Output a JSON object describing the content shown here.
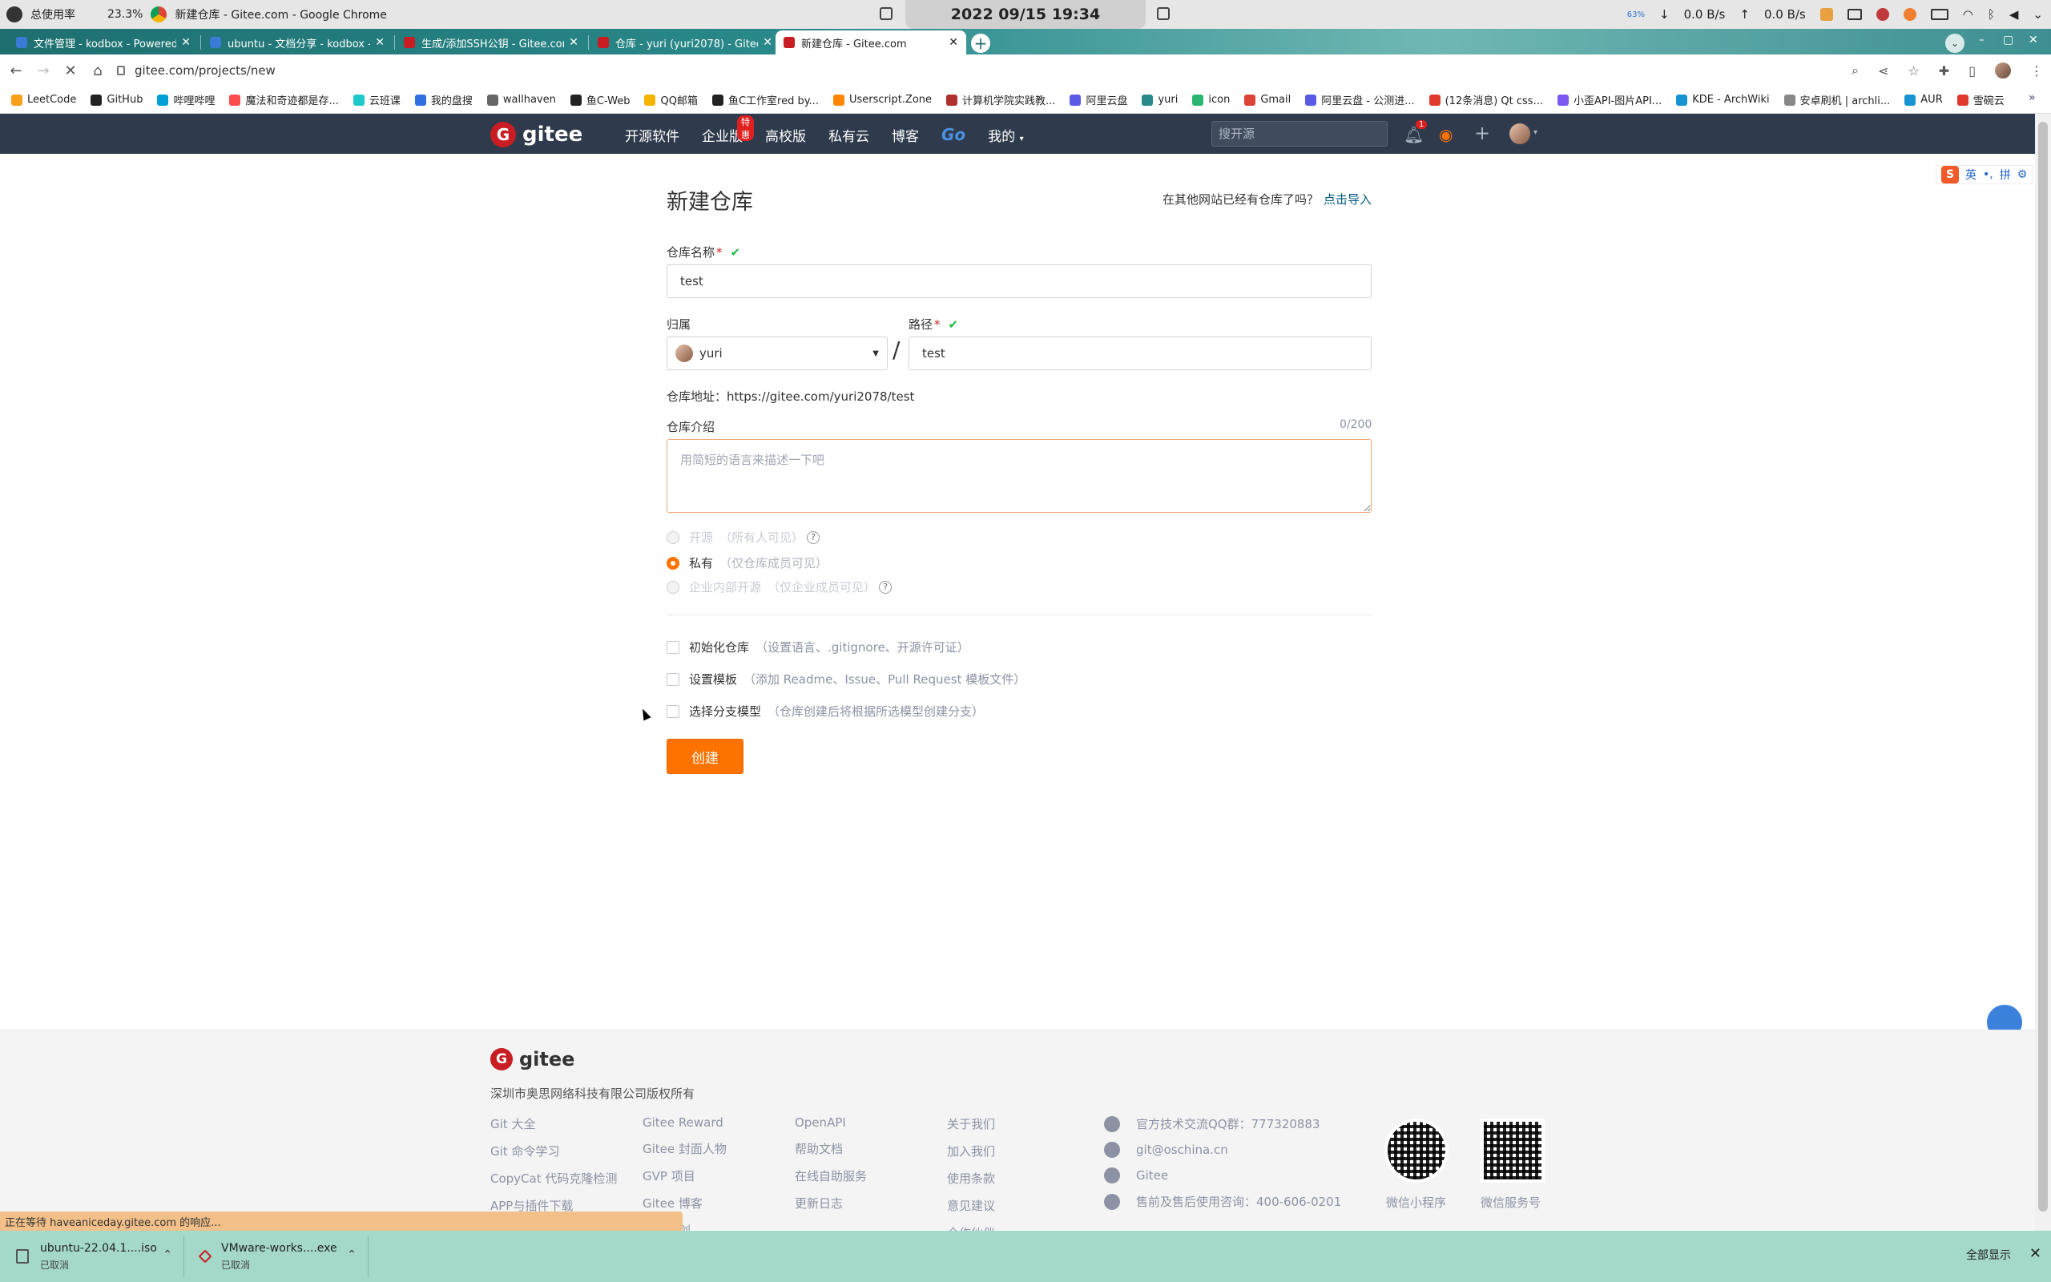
{
  "os_panel": {
    "cpu_label": "总使用率",
    "cpu_value": "23.3%",
    "window_title": "新建仓库 - Gitee.com - Google Chrome",
    "clock": "2022 09/15 19:34",
    "net_down": "0.0 B/s",
    "net_up": "0.0 B/s",
    "battery_small": "63%"
  },
  "tabs": [
    {
      "title": "文件管理 - kodbox - Powered",
      "color": "#3a7bd5"
    },
    {
      "title": "ubuntu - 文档分享 - kodbox -",
      "color": "#3a7bd5"
    },
    {
      "title": "生成/添加SSH公钥 - Gitee.com",
      "color": "#c71d23"
    },
    {
      "title": "仓库 - yuri (yuri2078) - Gitee.c",
      "color": "#c71d23"
    },
    {
      "title": "新建仓库 - Gitee.com",
      "color": "#c71d23",
      "active": true
    }
  ],
  "address": {
    "url": "gitee.com/projects/new"
  },
  "bookmarks": [
    {
      "label": "LeetCode",
      "color": "#f89f1b"
    },
    {
      "label": "GitHub",
      "color": "#222"
    },
    {
      "label": "哔哩哔哩",
      "color": "#00a1d6"
    },
    {
      "label": "魔法和奇迹都是存...",
      "color": "#ff4d4f"
    },
    {
      "label": "云班课",
      "color": "#1ec8c8"
    },
    {
      "label": "我的盘搜",
      "color": "#2f6fe0"
    },
    {
      "label": "wallhaven",
      "color": "#666"
    },
    {
      "label": "鱼C-Web",
      "color": "#222"
    },
    {
      "label": "QQ邮箱",
      "color": "#f4b400"
    },
    {
      "label": "鱼C工作室red by...",
      "color": "#222"
    },
    {
      "label": "Userscript.Zone",
      "color": "#ff8800"
    },
    {
      "label": "计算机学院实践教...",
      "color": "#b03030"
    },
    {
      "label": "阿里云盘",
      "color": "#5a5ae6"
    },
    {
      "label": "yuri",
      "color": "#2a8a8b"
    },
    {
      "label": "icon",
      "color": "#2ab573"
    },
    {
      "label": "Gmail",
      "color": "#db4437"
    },
    {
      "label": "阿里云盘 - 公测进...",
      "color": "#5a5ae6"
    },
    {
      "label": "(12条消息) Qt css...",
      "color": "#e03a2f"
    },
    {
      "label": "小歪API-图片API...",
      "color": "#7a5af0"
    },
    {
      "label": "KDE - ArchWiki",
      "color": "#1793d1"
    },
    {
      "label": "安卓刷机 | archli...",
      "color": "#888"
    },
    {
      "label": "AUR",
      "color": "#1793d1"
    },
    {
      "label": "雪碗云",
      "color": "#e03a2f"
    }
  ],
  "gitee_header": {
    "brand": "gitee",
    "brand_letter": "G",
    "nav": [
      "开源软件",
      "企业版",
      "高校版",
      "私有云",
      "博客"
    ],
    "nav_go": "Go",
    "nav_mine": "我的",
    "enterprise_badge": "特惠",
    "search_placeholder": "搜开源",
    "notif_count": "1"
  },
  "form": {
    "title": "新建仓库",
    "import_hint": "在其他网站已经有仓库了吗？",
    "import_link": "点击导入",
    "repo_name_label": "仓库名称",
    "repo_name_value": "test",
    "owner_label": "归属",
    "owner_value": "yuri",
    "path_label": "路径",
    "path_value": "test",
    "slash": "/",
    "repo_address": "仓库地址：https://gitee.com/yuri2078/test",
    "desc_label": "仓库介绍",
    "desc_counter": "0/200",
    "desc_placeholder": "用简短的语言来描述一下吧",
    "visibility": [
      {
        "label": "开源",
        "sub": "（所有人可见）",
        "disabled": true,
        "help": true
      },
      {
        "label": "私有",
        "sub": "（仅仓库成员可见）",
        "selected": true
      },
      {
        "label": "企业内部开源",
        "sub": "（仅企业成员可见）",
        "disabled": true,
        "help": true
      }
    ],
    "options": [
      {
        "label": "初始化仓库",
        "sub": "（设置语言、.gitignore、开源许可证）"
      },
      {
        "label": "设置模板",
        "sub": "（添加 Readme、Issue、Pull Request 模板文件）"
      },
      {
        "label": "选择分支模型",
        "sub": "（仓库创建后将根据所选模型创建分支）"
      }
    ],
    "create_button": "创建"
  },
  "ime": {
    "mode": "英",
    "pinyin": "拼"
  },
  "footer": {
    "brand": "gitee",
    "copyright": "深圳市奥思网络科技有限公司版权所有",
    "col1": [
      "Git 大全",
      "Git 命令学习",
      "CopyCat 代码克隆检测",
      "APP与插件下载"
    ],
    "col2": [
      "Gitee Reward",
      "Gitee 封面人物",
      "GVP 项目",
      "Gitee 博客",
      "公益计划"
    ],
    "col3": [
      "OpenAPI",
      "帮助文档",
      "在线自助服务",
      "更新日志"
    ],
    "col4": [
      "关于我们",
      "加入我们",
      "使用条款",
      "意见建议",
      "合作伙伴"
    ],
    "contacts": [
      "官方技术交流QQ群：777320883",
      "git@oschina.cn",
      "Gitee",
      "售前及售后使用咨询：400-606-0201"
    ],
    "qr1_label": "微信小程序",
    "qr2_label": "微信服务号"
  },
  "status_bubble": "正在等待 haveaniceday.gitee.com 的响应...",
  "downloads": [
    {
      "name": "ubuntu-22.04.1....iso",
      "status": "已取消"
    },
    {
      "name": "VMware-works....exe",
      "status": "已取消"
    }
  ],
  "downloads_show_all": "全部显示"
}
